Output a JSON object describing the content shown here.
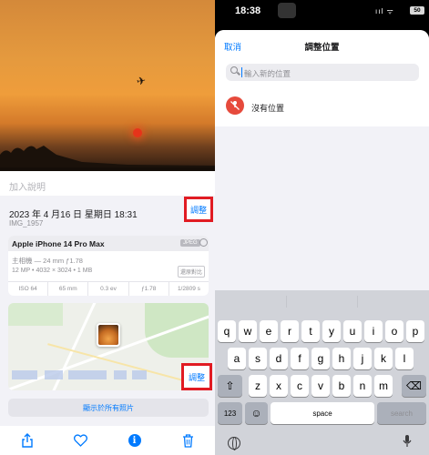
{
  "left": {
    "caption_placeholder": "加入說明",
    "date": "2023 年 4 月16 日 星期日 18:31",
    "filename": "IMG_1957",
    "adjust_label": "調整",
    "device": {
      "name": "Apple iPhone 14 Pro Max",
      "format_badge": "JPEG",
      "lens": "主相機 — 24 mm ƒ1.78",
      "specs": "12 MP • 4032 × 3024 • 1 MB",
      "portrait_badge": "還原對比",
      "exif": [
        "ISO 64",
        "65 mm",
        "0.3 ev",
        "ƒ1.78",
        "1/2809 s"
      ]
    },
    "map_adjust_label": "調整",
    "show_all_label": "顯示於所有照片",
    "toolbar": {
      "share_icon": "share-icon",
      "favorite_icon": "heart-icon",
      "info_icon": "info-icon",
      "delete_icon": "trash-icon",
      "info_glyph": "i"
    }
  },
  "right": {
    "status": {
      "time": "18:38",
      "battery": "50",
      "signal_text": "ııl ᯤ"
    },
    "sheet": {
      "cancel_label": "取消",
      "title": "調整位置",
      "search_placeholder": "輸入新的位置",
      "no_location_label": "沒有位置"
    },
    "keyboard": {
      "row1": [
        "q",
        "w",
        "e",
        "r",
        "t",
        "y",
        "u",
        "i",
        "o",
        "p"
      ],
      "row2": [
        "a",
        "s",
        "d",
        "f",
        "g",
        "h",
        "j",
        "k",
        "l"
      ],
      "row3": [
        "z",
        "x",
        "c",
        "v",
        "b",
        "n",
        "m"
      ],
      "numbers_label": "123",
      "space_label": "space",
      "return_label": "search",
      "shift_glyph": "⇧",
      "delete_glyph": "⌫",
      "emoji_glyph": "☺"
    }
  },
  "colors": {
    "accent": "#007aff",
    "highlight_box": "#e11b22",
    "no_location": "#e64a3c"
  }
}
